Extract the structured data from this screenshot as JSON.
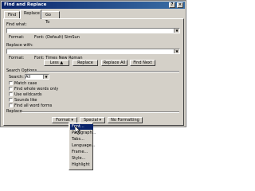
{
  "window": {
    "title": "Find and Replace",
    "help_btn": "?",
    "close_btn": "×"
  },
  "tabs": [
    {
      "label": "Find",
      "active": false
    },
    {
      "label": "Replace",
      "active": true
    },
    {
      "label": "Go To",
      "active": false
    }
  ],
  "find": {
    "label": "Find what:",
    "value": "",
    "format_label": "Format:",
    "format_value": "Font: (Default) SimSun"
  },
  "replace": {
    "label": "Replace with:",
    "value": "",
    "format_label": "Format:",
    "format_value": "Font: Times New Roman"
  },
  "buttons": {
    "less": "Less",
    "replace": "Replace",
    "replace_all": "Replace All",
    "find_next": "Find Next",
    "format": "Format",
    "special": "Special",
    "no_formatting": "No Formatting"
  },
  "search_options": {
    "group_label": "Search Options",
    "search_label": "Search:",
    "search_value": "All",
    "checkboxes": [
      "Match case",
      "Find whole words only",
      "Use wildcards",
      "Sounds like",
      "Find all word forms"
    ]
  },
  "replace_section_label": "Replace",
  "format_menu": {
    "items": [
      "Font...",
      "Paragraph...",
      "Tabs...",
      "Language...",
      "Frame...",
      "Style...",
      "Highlight"
    ],
    "selected_index": 0
  }
}
